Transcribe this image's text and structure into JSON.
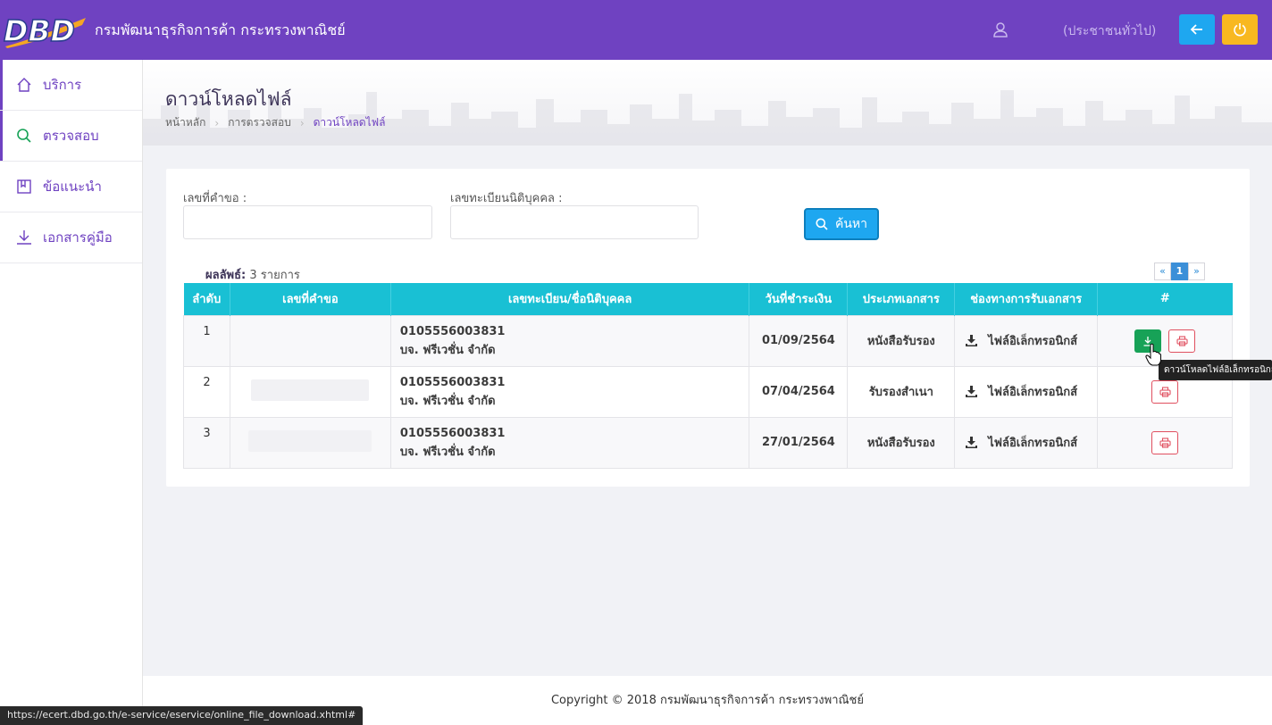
{
  "header": {
    "logo_text": "DBD",
    "site_title": "กรมพัฒนาธุรกิจการค้า กระทรวงพาณิชย์",
    "user_role": "(ประชาชนทั่วไป)",
    "icons": {
      "user": "user-icon",
      "back": "arrow-left-icon",
      "power": "power-icon"
    },
    "colors": {
      "bar": "#6f42c1",
      "back": "#1ea7f0",
      "power": "#f8b820"
    }
  },
  "sidebar": {
    "items": [
      {
        "label": "บริการ",
        "icon": "home-icon"
      },
      {
        "label": "ตรวจสอบ",
        "icon": "search-icon"
      },
      {
        "label": "ข้อแนะนำ",
        "icon": "book-icon"
      },
      {
        "label": "เอกสารคู่มือ",
        "icon": "download-icon"
      }
    ]
  },
  "page": {
    "title": "ดาวน์โหลดไฟล์",
    "breadcrumb": [
      "หน้าหลัก",
      "การตรวจสอบ",
      "ดาวน์โหลดไฟล์"
    ]
  },
  "form": {
    "request_no_label": "เลขที่คำขอ :",
    "request_no_value": "",
    "reg_no_label": "เลขทะเบียนนิติบุคคล :",
    "reg_no_value": "",
    "search_label": "ค้นหา"
  },
  "results": {
    "label": "ผลลัพธ์:",
    "count_text": "3 รายการ",
    "pager": {
      "prev": "«",
      "current": "1",
      "next": "»"
    }
  },
  "table": {
    "headers": [
      "ลำดับ",
      "เลขที่คำขอ",
      "เลขทะเบียน/ชื่อนิติบุคคล",
      "วันที่ชำระเงิน",
      "ประเภทเอกสาร",
      "ช่องทางการรับเอกสาร",
      "#"
    ],
    "rows": [
      {
        "no": "1",
        "request_no": "",
        "reg_no": "0105556003831",
        "company": "บจ. ฟรีเวชั่น จำกัด",
        "paid_date": "01/09/2564",
        "doc_type": "หนังสือรับรอง",
        "channel": "ไฟล์อิเล็กทรอนิกส์"
      },
      {
        "no": "2",
        "request_no": "",
        "reg_no": "0105556003831",
        "company": "บจ. ฟรีเวชั่น จำกัด",
        "paid_date": "07/04/2564",
        "doc_type": "รับรองสำเนา",
        "channel": "ไฟล์อิเล็กทรอนิกส์"
      },
      {
        "no": "3",
        "request_no": "",
        "reg_no": "0105556003831",
        "company": "บจ. ฟรีเวชั่น จำกัด",
        "paid_date": "27/01/2564",
        "doc_type": "หนังสือรับรอง",
        "channel": "ไฟล์อิเล็กทรอนิกส์"
      }
    ]
  },
  "tooltip": "ดาวน์โหลดไฟล์อิเล็กทรอนิกส์",
  "footer": "Copyright © 2018 กรมพัฒนาธุรกิจการค้า กระทรวงพาณิชย์",
  "statusbar": "https://ecert.dbd.go.th/e-service/eservice/online_file_download.xhtml#"
}
